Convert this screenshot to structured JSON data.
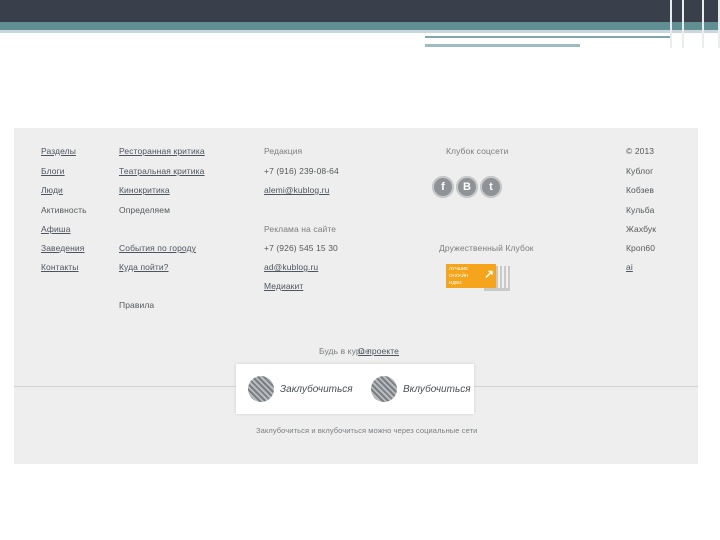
{
  "footer": {
    "col1": [
      "Разделы",
      "Блоги",
      "Люди",
      "Активность",
      "Афиша",
      "Заведения",
      "Контакты"
    ],
    "col2": {
      "group1": [
        "Ресторанная критика",
        "Театральная критика",
        "Кинокритика",
        "Определяем"
      ],
      "group2": [
        "События по городу",
        "Куда пойти?"
      ],
      "extra": "Правила"
    },
    "col3": {
      "edit_title": "Редакция",
      "edit_phone": "+7 (916) 239-08-64",
      "edit_email": "alemi@kublog.ru",
      "ads_title": "Реклама на сайте",
      "ads_phone": "+7 (926) 545 15 30",
      "ads_email": "ad@kublog.ru",
      "ads_link": "Медиакит"
    },
    "social_title": "Клубок соцсети",
    "social_icons": [
      "f",
      "В",
      "t"
    ],
    "partner_title": "Дружественный Клубок",
    "banner_lines": [
      "ЛУЧШИЕ",
      "ОНЛАЙН",
      "ИДЕИ"
    ],
    "col5": [
      "© 2013",
      "Кублог",
      "Кобзев",
      "Кульба",
      "Жахбук",
      "Кроп60",
      "ai"
    ],
    "about_text": "Будь в курсе",
    "about_link": "О проекте",
    "btn_left": "Заклубочиться",
    "btn_right": "Вклубочиться",
    "bottom_note": "Заклубочиться и вклубочиться можно через социальные сети"
  }
}
